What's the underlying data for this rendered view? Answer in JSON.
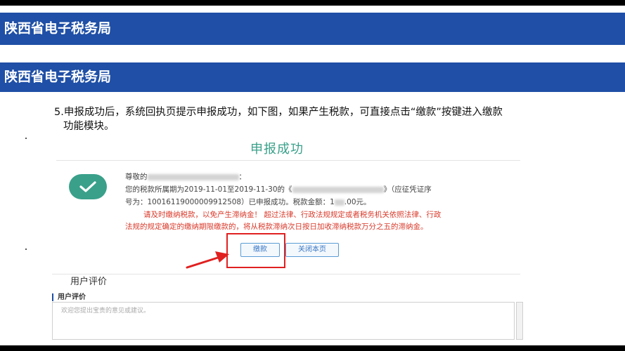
{
  "slide": {
    "header_title_1": "陕西省电子税务局",
    "header_title_2": "陕西省电子税务局",
    "step_line_1": "5.申报成功后，系统回执页提示申报成功，如下图，如果产生税款，可直接点击“缴款”按键进入缴款",
    "step_line_2": "功能模块。"
  },
  "screenshot": {
    "success_title": "申报成功",
    "greeting": "尊敬的",
    "greeting_end": "：",
    "period_prefix": "您的税款所属期为2019-11-01至2019-11-30的《",
    "period_suffix": "》（应征凭证序",
    "voucher_line_prefix": "号为：10016119000009912508）已申报成功。税款金额：",
    "voucher_line_amount": "1",
    "voucher_line_suffix": ".00元。",
    "warning_line_1": "请及时缴纳税款，以免产生滞纳金！ 超过法律、行政法规规定或者税务机关依照法律、行政",
    "warning_line_2": "法规的规定确定的缴纳期限缴款的，将从税款滞纳次日按日加收滞纳税款万分之五的滞纳金。",
    "pay_button": "缴款",
    "close_button": "关闭本页",
    "review_heading": "用户评价",
    "review_subheading": "用户评价",
    "review_placeholder": "欢迎您提出宝贵的意见或建议。"
  },
  "colors": {
    "banner": "#1f4fa6",
    "success_green": "#3aa08a",
    "warning_red": "#d93a2b",
    "highlight_red": "#e02020"
  }
}
